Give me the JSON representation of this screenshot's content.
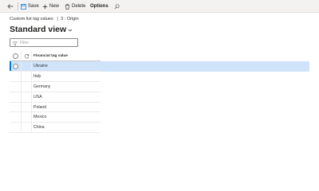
{
  "toolbar": {
    "save_label": "Save",
    "new_label": "New",
    "delete_label": "Delete",
    "options_label": "Options"
  },
  "breadcrumb": {
    "text": "Custom list tag values   |  3 : Origin"
  },
  "page": {
    "title": "Standard view"
  },
  "filter": {
    "placeholder": "Filter",
    "value": ""
  },
  "grid": {
    "column_header": "Financial tag value",
    "rows": [
      "Ukraine",
      "Italy",
      "Germany",
      "USA",
      "Poland",
      "Mexico",
      "China"
    ],
    "selected_index": 0
  },
  "icons": {
    "back": "back-arrow-icon",
    "save": "save-icon",
    "new": "plus-icon",
    "delete": "trash-icon",
    "search": "search-icon",
    "filter": "filter-icon",
    "chevron": "chevron-down-icon",
    "refresh": "refresh-icon"
  },
  "colors": {
    "accent": "#0078d4",
    "selected_row": "#cfe4fa",
    "toolbar_bg": "#f3f2f1"
  }
}
